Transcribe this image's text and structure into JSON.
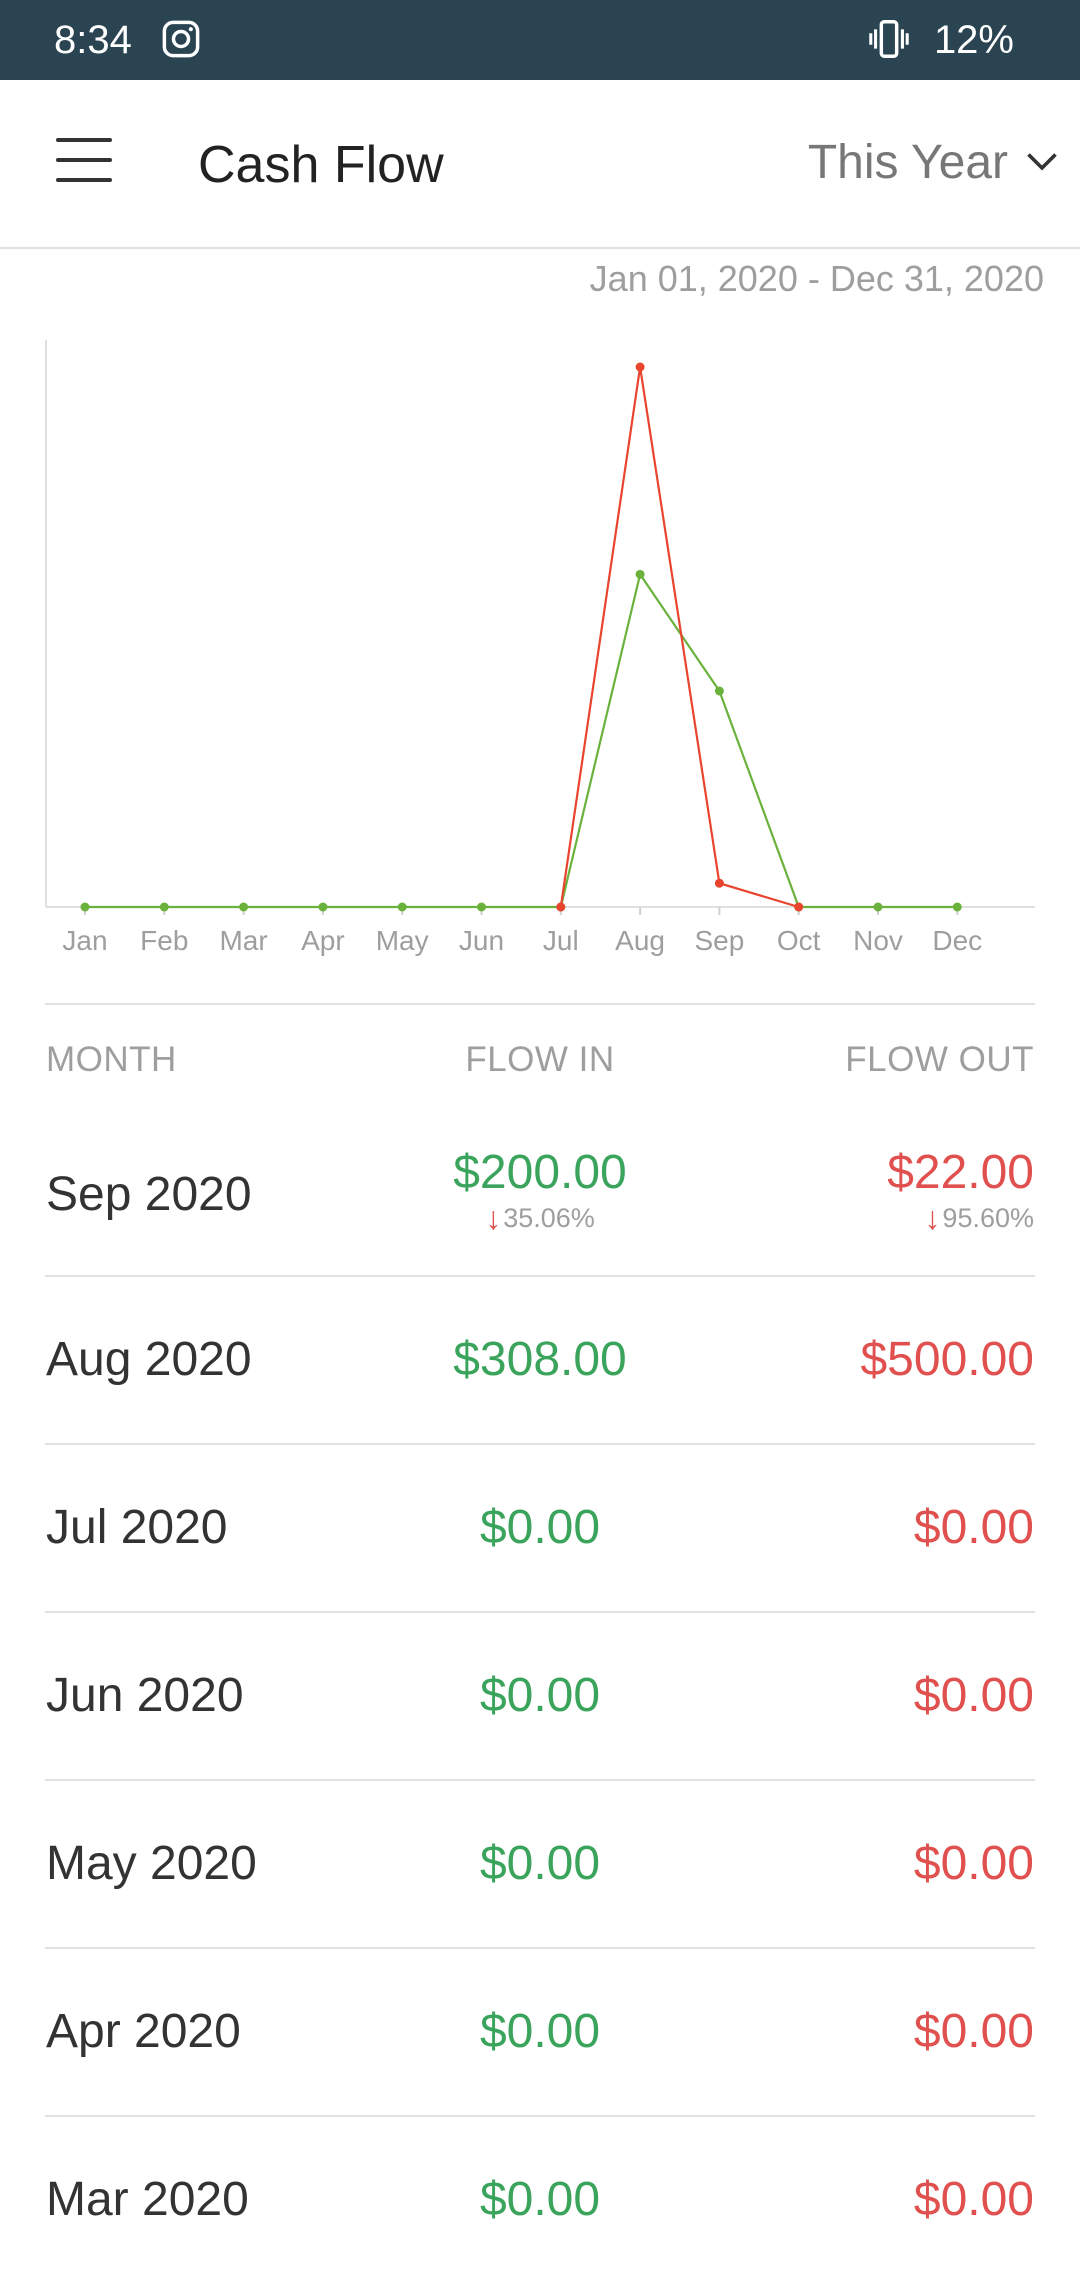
{
  "status_bar": {
    "time": "8:34",
    "battery": "12%",
    "icons": [
      "instagram-icon",
      "vibrate-icon"
    ]
  },
  "app_bar": {
    "title": "Cash Flow",
    "period": "This Year"
  },
  "date_range": "Jan 01, 2020 - Dec 31, 2020",
  "colors": {
    "flow_in": "#3aa45c",
    "flow_out": "#e0504e",
    "line_in": "#6ab23c",
    "line_out": "#e8442e"
  },
  "chart_data": {
    "type": "line",
    "categories": [
      "Jan",
      "Feb",
      "Mar",
      "Apr",
      "May",
      "Jun",
      "Jul",
      "Aug",
      "Sep",
      "Oct",
      "Nov",
      "Dec"
    ],
    "series": [
      {
        "values": [
          0,
          0,
          0,
          0,
          0,
          0,
          0,
          308,
          200,
          0,
          0,
          0
        ],
        "color": "#6ab23c"
      },
      {
        "values": [
          null,
          null,
          null,
          null,
          null,
          null,
          0,
          500,
          22,
          0,
          null,
          null
        ],
        "color": "#e8442e"
      }
    ],
    "ylim": [
      0,
      525
    ],
    "grid": false
  },
  "table": {
    "headers": {
      "month": "MONTH",
      "flow_in": "FLOW IN",
      "flow_out": "FLOW OUT"
    },
    "rows": [
      {
        "month": "Sep 2020",
        "flow_in": "$200.00",
        "flow_out": "$22.00",
        "in_change": "35.06%",
        "out_change": "95.60%"
      },
      {
        "month": "Aug 2020",
        "flow_in": "$308.00",
        "flow_out": "$500.00"
      },
      {
        "month": "Jul 2020",
        "flow_in": "$0.00",
        "flow_out": "$0.00"
      },
      {
        "month": "Jun 2020",
        "flow_in": "$0.00",
        "flow_out": "$0.00"
      },
      {
        "month": "May 2020",
        "flow_in": "$0.00",
        "flow_out": "$0.00"
      },
      {
        "month": "Apr 2020",
        "flow_in": "$0.00",
        "flow_out": "$0.00"
      },
      {
        "month": "Mar 2020",
        "flow_in": "$0.00",
        "flow_out": "$0.00"
      }
    ]
  }
}
